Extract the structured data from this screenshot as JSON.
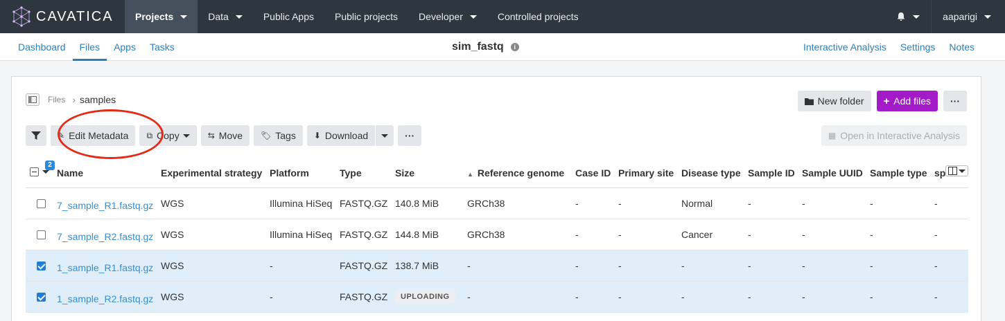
{
  "app": {
    "name": "CAVATICA",
    "brand_color": "#2e3640",
    "accent_color": "#a31ac9",
    "link_color": "#2e7fb8"
  },
  "topnav": {
    "items": [
      {
        "label": "Projects",
        "active": true,
        "dropdown": true
      },
      {
        "label": "Data",
        "dropdown": true
      },
      {
        "label": "Public Apps"
      },
      {
        "label": "Public projects"
      },
      {
        "label": "Developer",
        "dropdown": true
      },
      {
        "label": "Controlled projects"
      }
    ],
    "user": "aaparigi",
    "bell_icon": "bell-icon"
  },
  "subnav": {
    "left": [
      "Dashboard",
      "Files",
      "Apps",
      "Tasks"
    ],
    "active": "Files",
    "project_title": "sim_fastq",
    "right": [
      "Interactive Analysis",
      "Settings",
      "Notes"
    ]
  },
  "breadcrumb": {
    "root": "Files",
    "current": "samples"
  },
  "actions": {
    "new_folder": "New folder",
    "add_files": "Add files",
    "more": "···"
  },
  "toolbar": {
    "edit_metadata": "Edit Metadata",
    "copy": "Copy",
    "move": "Move",
    "tags": "Tags",
    "download": "Download",
    "more": "···",
    "open_ia": "Open in Interactive Analysis"
  },
  "table": {
    "selected_count": "2",
    "headers": [
      "Name",
      "Experimental strategy",
      "Platform",
      "Type",
      "Size",
      "Reference genome",
      "Case ID",
      "Primary site",
      "Disease type",
      "Sample ID",
      "Sample UUID",
      "Sample type",
      "sp"
    ],
    "rows": [
      {
        "checked": false,
        "name": "7_sample_R1.fastq.gz",
        "strategy": "WGS",
        "platform": "Illumina HiSeq",
        "type": "FASTQ.GZ",
        "size": "140.8 MiB",
        "ref": "GRCh38",
        "case": "-",
        "site": "-",
        "disease": "Normal",
        "sid": "-",
        "suuid": "-",
        "stype": "-",
        "sp": "-"
      },
      {
        "checked": false,
        "name": "7_sample_R2.fastq.gz",
        "strategy": "WGS",
        "platform": "Illumina HiSeq",
        "type": "FASTQ.GZ",
        "size": "144.8 MiB",
        "ref": "GRCh38",
        "case": "-",
        "site": "-",
        "disease": "Cancer",
        "sid": "-",
        "suuid": "-",
        "stype": "-",
        "sp": "-"
      },
      {
        "checked": true,
        "name": "1_sample_R1.fastq.gz",
        "strategy": "WGS",
        "platform": "-",
        "type": "FASTQ.GZ",
        "size": "138.7 MiB",
        "ref": "-",
        "case": "-",
        "site": "-",
        "disease": "-",
        "sid": "-",
        "suuid": "-",
        "stype": "-",
        "sp": "-"
      },
      {
        "checked": true,
        "name": "1_sample_R2.fastq.gz",
        "strategy": "WGS",
        "platform": "-",
        "type": "FASTQ.GZ",
        "size": "UPLOADING",
        "ref": "-",
        "case": "-",
        "site": "-",
        "disease": "-",
        "sid": "-",
        "suuid": "-",
        "stype": "-",
        "sp": "-"
      }
    ]
  }
}
